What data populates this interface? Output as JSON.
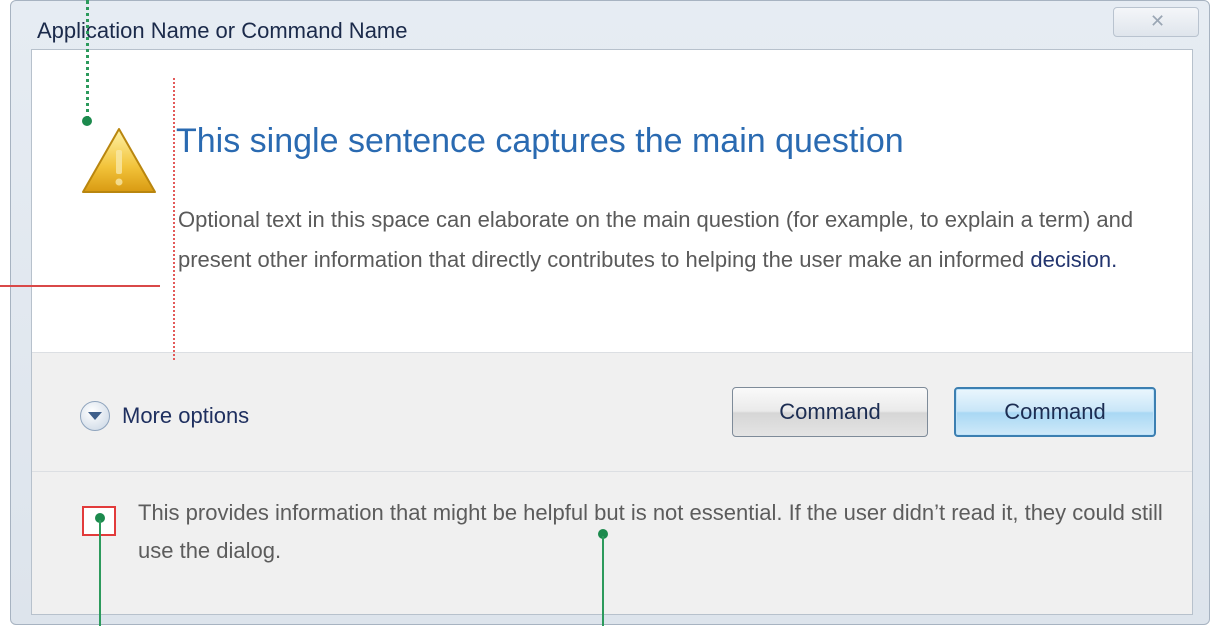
{
  "window": {
    "title": "Application Name or Command Name",
    "close_glyph": "✕"
  },
  "content": {
    "main_instruction": "This single sentence captures the main question",
    "body_text": "Optional text in this space can elaborate on the main question (for example, to explain a term) and present other information that directly contributes to helping the user make an informed ",
    "body_link": "decision."
  },
  "footer": {
    "more_options_label": "More options",
    "command_1_label": "Command",
    "command_2_label": "Command",
    "footnote_text": "This provides information that might be helpful but is not essential.  If the user didn’t read it, they could still use the dialog."
  },
  "icons": {
    "main": "warning-icon",
    "expand": "chevron-down-icon",
    "close": "close-icon"
  },
  "colors": {
    "main_instruction": "#2a6ab1",
    "annotation_green": "#1c8a4d",
    "annotation_red": "#d94848"
  }
}
